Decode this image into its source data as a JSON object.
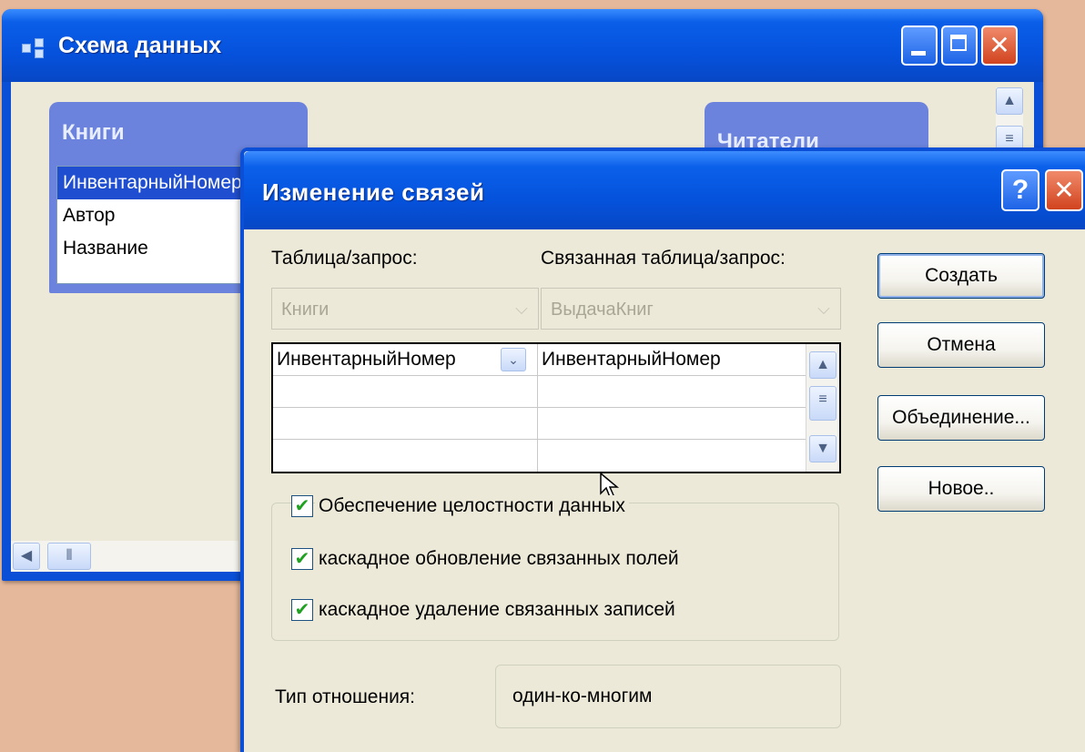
{
  "main_window": {
    "title": "Схема данных",
    "tables": [
      {
        "title": "Книги",
        "fields": [
          "ИнвентарныйНомер",
          "Автор",
          "Название"
        ],
        "selected_index": 0
      },
      {
        "title": "Читатели",
        "fields": []
      }
    ]
  },
  "dialog": {
    "title": "Изменение связей",
    "table_label": "Таблица/запрос:",
    "related_table_label": "Связанная таблица/запрос:",
    "table_value": "Книги",
    "related_table_value": "ВыдачаКниг",
    "grid_rows": [
      {
        "left": "ИнвентарныйНомер",
        "right": "ИнвентарныйНомер"
      },
      {
        "left": "",
        "right": ""
      },
      {
        "left": "",
        "right": ""
      },
      {
        "left": "",
        "right": ""
      }
    ],
    "integrity": {
      "label": "Обеспечение целостности данных",
      "checked": true
    },
    "cascade_update": {
      "label": "каскадное обновление связанных полей",
      "checked": true
    },
    "cascade_delete": {
      "label": "каскадное удаление связанных записей",
      "checked": true
    },
    "relation_type_label": "Тип отношения:",
    "relation_type_value": "один-ко-многим",
    "buttons": {
      "create": "Создать",
      "cancel": "Отмена",
      "join": "Объединение...",
      "new": "Новое.."
    }
  },
  "icons": {
    "help": "?",
    "close": "✕"
  }
}
